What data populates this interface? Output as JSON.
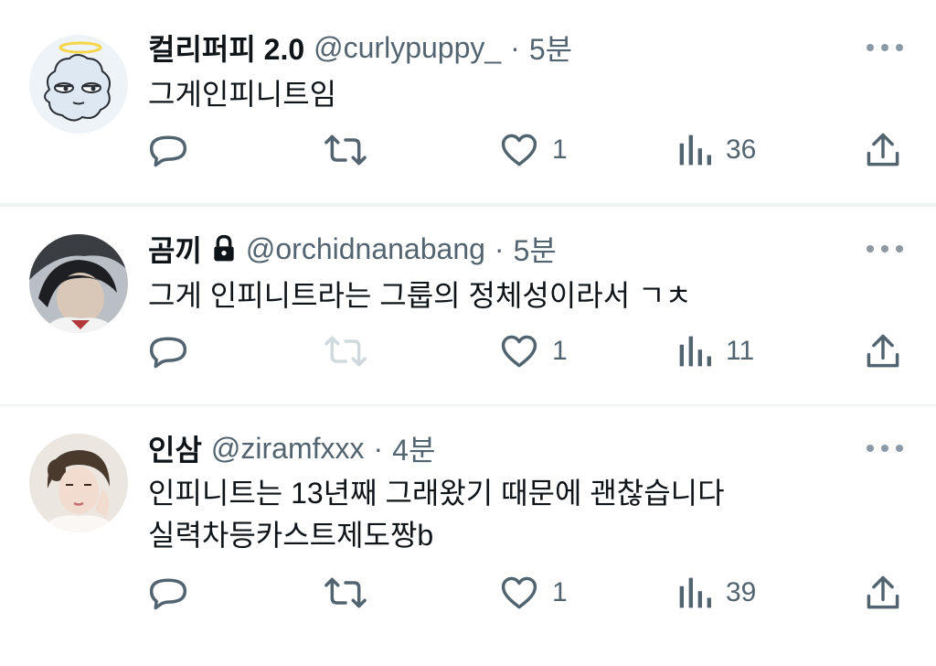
{
  "tweets": [
    {
      "display_name": "컬리퍼피 2.0",
      "handle": "@curlypuppy_",
      "dot": "·",
      "time": "5분",
      "text": "그게인피니트임",
      "likes": "1",
      "views": "36",
      "retweet_enabled": true,
      "protected": false
    },
    {
      "display_name": "곰끼",
      "handle": "@orchidnanabang",
      "dot": "·",
      "time": "5분",
      "text": "그게 인피니트라는 그룹의 정체성이라서 ㄱㅊ",
      "likes": "1",
      "views": "11",
      "retweet_enabled": false,
      "protected": true
    },
    {
      "display_name": "인삼",
      "handle": "@ziramfxxx",
      "dot": "·",
      "time": "4분",
      "text": "인피니트는 13년째 그래왔기 때문에 괜찮습니다\n실력차등카스트제도짱b",
      "likes": "1",
      "views": "39",
      "retweet_enabled": true,
      "protected": false
    }
  ],
  "colors": {
    "text": "#0f1419",
    "secondary": "#536471",
    "icon": "#536471",
    "icon_disabled": "#cfd9de",
    "divider": "#eff3f4",
    "halo": "#f5d64a"
  },
  "icons": {
    "reply": "reply-icon",
    "retweet": "retweet-icon",
    "like": "heart-icon",
    "views": "views-icon",
    "share": "share-icon",
    "more": "more-icon",
    "lock": "lock-icon"
  }
}
